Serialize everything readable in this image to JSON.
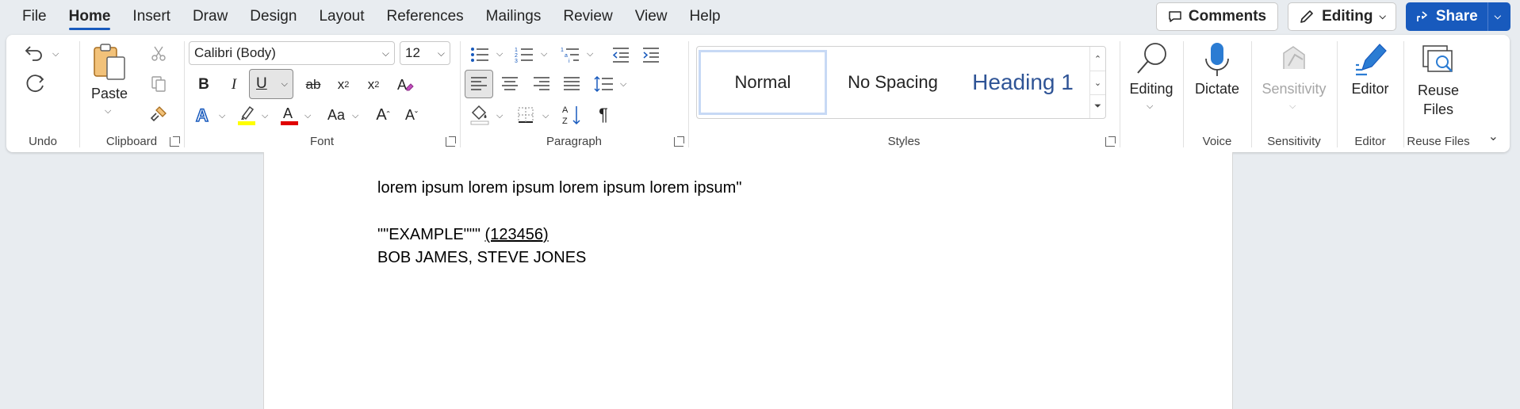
{
  "menu": {
    "items": [
      "File",
      "Home",
      "Insert",
      "Draw",
      "Design",
      "Layout",
      "References",
      "Mailings",
      "Review",
      "View",
      "Help"
    ],
    "active": "Home"
  },
  "top_right": {
    "comments_label": "Comments",
    "editing_label": "Editing",
    "share_label": "Share"
  },
  "ribbon": {
    "undo": {
      "group_label": "Undo"
    },
    "clipboard": {
      "group_label": "Clipboard",
      "paste_label": "Paste"
    },
    "font": {
      "group_label": "Font",
      "font_name": "Calibri (Body)",
      "font_size": "12",
      "change_case_label": "Aa"
    },
    "paragraph": {
      "group_label": "Paragraph"
    },
    "styles": {
      "group_label": "Styles",
      "tiles": [
        "Normal",
        "No Spacing",
        "Heading 1"
      ]
    },
    "editing": {
      "label": "Editing"
    },
    "voice": {
      "group_label": "Voice",
      "dictate_label": "Dictate"
    },
    "sensitivity": {
      "group_label": "Sensitivity",
      "label": "Sensitivity"
    },
    "editor": {
      "group_label": "Editor",
      "label": "Editor"
    },
    "reuse_files": {
      "group_label": "Reuse Files",
      "label_line1": "Reuse",
      "label_line2": "Files"
    }
  },
  "document": {
    "line1": "lorem ipsum lorem ipsum lorem ipsum lorem ipsum\"",
    "line2_part1": "\"\"EXAMPLE\"\"\" ",
    "line2_part2": "(123456)",
    "line3": "BOB JAMES, STEVE JONES"
  },
  "colors": {
    "accent": "#185abd",
    "highlight_yellow": "#ffff00",
    "font_red": "#e00000"
  }
}
